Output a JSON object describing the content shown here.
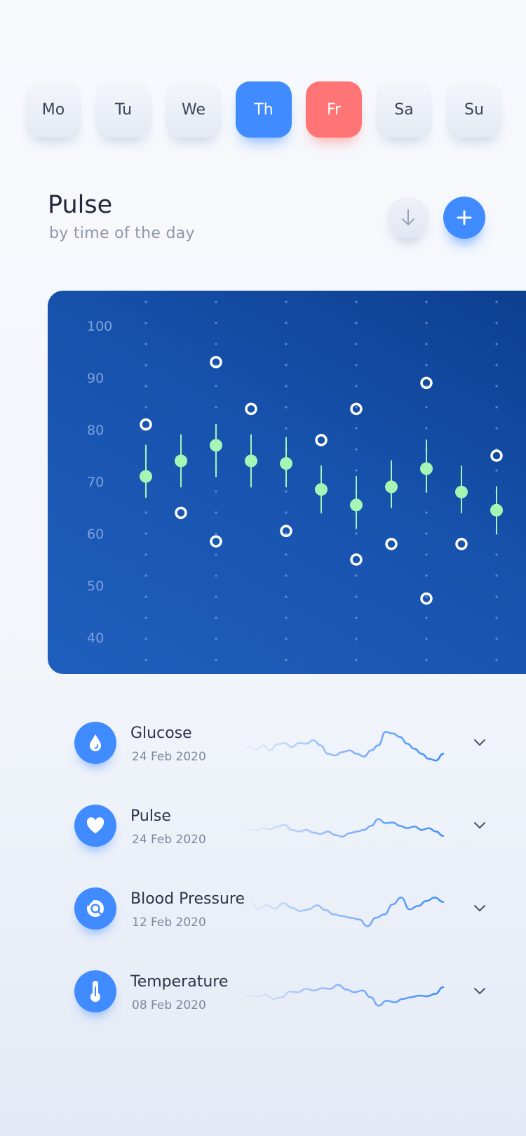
{
  "days": [
    {
      "label": "Mo",
      "state": "normal"
    },
    {
      "label": "Tu",
      "state": "normal"
    },
    {
      "label": "We",
      "state": "normal"
    },
    {
      "label": "Th",
      "state": "selected"
    },
    {
      "label": "Fr",
      "state": "today"
    },
    {
      "label": "Sa",
      "state": "normal"
    },
    {
      "label": "Su",
      "state": "normal"
    }
  ],
  "header": {
    "title": "Pulse",
    "subtitle": "by time of the day",
    "download_icon": "arrow-down-icon",
    "add_icon": "plus-icon"
  },
  "colors": {
    "accent": "#3f8bff",
    "today": "#ff7575",
    "chart_bg": "#1752ad",
    "point": "#a7f5b4"
  },
  "chart_data": {
    "type": "scatter",
    "y_ticks": [
      100,
      90,
      80,
      70,
      60,
      50,
      40
    ],
    "ylim": [
      40,
      100
    ],
    "columns": [
      {
        "avg": 71,
        "range": [
          67,
          77
        ],
        "max": 81,
        "min": null
      },
      {
        "avg": 74,
        "range": [
          69,
          79
        ],
        "max": null,
        "min": 64
      },
      {
        "avg": 77,
        "range": [
          71,
          81
        ],
        "max": 93,
        "min": 58.5
      },
      {
        "avg": 74,
        "range": [
          69,
          79
        ],
        "max": 84,
        "min": null
      },
      {
        "avg": 73.5,
        "range": [
          69,
          78.5
        ],
        "max": null,
        "min": 60.5
      },
      {
        "avg": 68.5,
        "range": [
          64,
          73
        ],
        "max": 78,
        "min": null
      },
      {
        "avg": 65.5,
        "range": [
          61,
          71
        ],
        "max": 84,
        "min": 55
      },
      {
        "avg": 69,
        "range": [
          65,
          74
        ],
        "max": null,
        "min": 58
      },
      {
        "avg": 72.5,
        "range": [
          68,
          78
        ],
        "max": 89,
        "min": 47.5
      },
      {
        "avg": 68,
        "range": [
          64,
          73
        ],
        "max": null,
        "min": 58
      },
      {
        "avg": 64.5,
        "range": [
          60,
          69
        ],
        "max": 75,
        "min": null
      }
    ]
  },
  "metrics": [
    {
      "name": "Glucose",
      "date": "24 Feb 2020",
      "icon": "drop-icon",
      "spark": [
        0.45,
        0.5,
        0.42,
        0.55,
        0.4,
        0.58,
        0.62,
        0.5,
        0.62,
        0.6,
        0.7,
        0.55,
        0.3,
        0.25,
        0.35,
        0.4,
        0.3,
        0.22,
        0.4,
        0.55,
        0.95,
        0.9,
        0.8,
        0.6,
        0.45,
        0.3,
        0.15,
        0.1,
        0.3
      ]
    },
    {
      "name": "Pulse",
      "date": "24 Feb 2020",
      "icon": "heart-icon",
      "spark": [
        0.45,
        0.5,
        0.48,
        0.55,
        0.52,
        0.6,
        0.65,
        0.5,
        0.45,
        0.5,
        0.42,
        0.38,
        0.45,
        0.35,
        0.3,
        0.4,
        0.45,
        0.5,
        0.62,
        0.82,
        0.7,
        0.72,
        0.62,
        0.55,
        0.6,
        0.5,
        0.55,
        0.45,
        0.32
      ]
    },
    {
      "name": "Blood Pressure",
      "date": "12 Feb 2020",
      "icon": "gauge-icon",
      "spark": [
        0.7,
        0.9,
        0.6,
        0.72,
        0.62,
        0.78,
        0.65,
        0.55,
        0.6,
        0.72,
        0.58,
        0.45,
        0.4,
        0.35,
        0.3,
        0.1,
        0.35,
        0.45,
        0.75,
        0.95,
        0.6,
        0.7,
        0.85,
        0.95,
        0.82
      ]
    },
    {
      "name": "Temperature",
      "date": "08 Feb 2020",
      "icon": "thermometer-icon",
      "spark": [
        0.45,
        0.5,
        0.48,
        0.52,
        0.4,
        0.45,
        0.62,
        0.6,
        0.7,
        0.65,
        0.72,
        0.7,
        0.82,
        0.68,
        0.6,
        0.65,
        0.45,
        0.2,
        0.35,
        0.3,
        0.4,
        0.45,
        0.5,
        0.48,
        0.55,
        0.75
      ]
    }
  ],
  "chevron_icon": "chevron-down-icon"
}
